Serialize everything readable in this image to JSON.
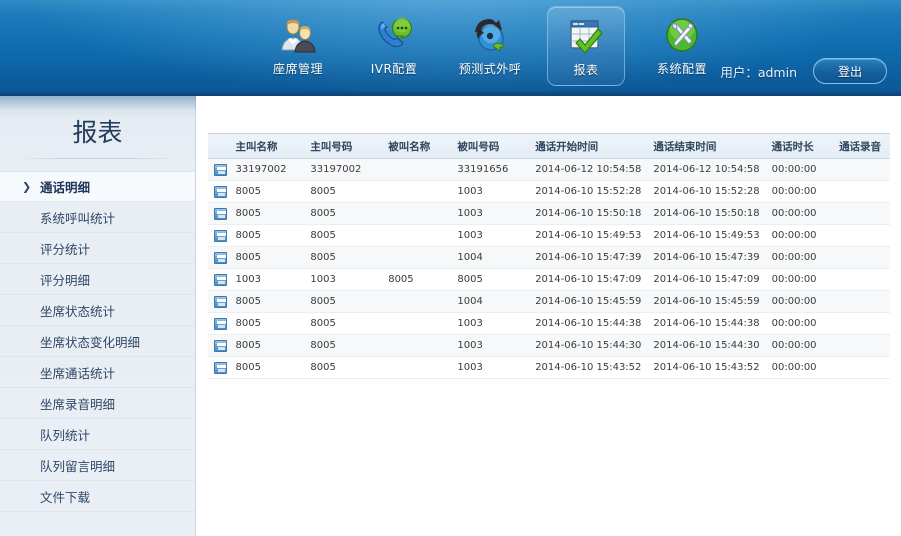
{
  "header": {
    "nav": [
      {
        "label": "座席管理",
        "icon": "users-icon",
        "active": false
      },
      {
        "label": "IVR配置",
        "icon": "phone-chat-icon",
        "active": false
      },
      {
        "label": "预测式外呼",
        "icon": "outbound-call-icon",
        "active": false
      },
      {
        "label": "报表",
        "icon": "report-checkmark-icon",
        "active": true
      },
      {
        "label": "系统配置",
        "icon": "tools-gear-icon",
        "active": false
      }
    ],
    "user_info": "用户：admin",
    "logout_label": "登出"
  },
  "sidebar": {
    "title": "报表",
    "items": [
      {
        "label": "通话明细",
        "active": true
      },
      {
        "label": "系统呼叫统计",
        "active": false
      },
      {
        "label": "评分统计",
        "active": false
      },
      {
        "label": "评分明细",
        "active": false
      },
      {
        "label": "坐席状态统计",
        "active": false
      },
      {
        "label": "坐席状态变化明细",
        "active": false
      },
      {
        "label": "坐席通话统计",
        "active": false
      },
      {
        "label": "坐席录音明细",
        "active": false
      },
      {
        "label": "队列统计",
        "active": false
      },
      {
        "label": "队列留言明细",
        "active": false
      },
      {
        "label": "文件下载",
        "active": false
      }
    ]
  },
  "table": {
    "columns": [
      "主叫名称",
      "主叫号码",
      "被叫名称",
      "被叫号码",
      "通话开始时间",
      "通话结束时间",
      "通话时长",
      "通话录音"
    ],
    "rows": [
      [
        "33197002",
        "33197002",
        "",
        "33191656",
        "2014-06-12 10:54:58",
        "2014-06-12 10:54:58",
        "00:00:00",
        ""
      ],
      [
        "8005",
        "8005",
        "",
        "1003",
        "2014-06-10 15:52:28",
        "2014-06-10 15:52:28",
        "00:00:00",
        ""
      ],
      [
        "8005",
        "8005",
        "",
        "1003",
        "2014-06-10 15:50:18",
        "2014-06-10 15:50:18",
        "00:00:00",
        ""
      ],
      [
        "8005",
        "8005",
        "",
        "1003",
        "2014-06-10 15:49:53",
        "2014-06-10 15:49:53",
        "00:00:00",
        ""
      ],
      [
        "8005",
        "8005",
        "",
        "1004",
        "2014-06-10 15:47:39",
        "2014-06-10 15:47:39",
        "00:00:00",
        ""
      ],
      [
        "1003",
        "1003",
        "8005",
        "8005",
        "2014-06-10 15:47:09",
        "2014-06-10 15:47:09",
        "00:00:00",
        ""
      ],
      [
        "8005",
        "8005",
        "",
        "1004",
        "2014-06-10 15:45:59",
        "2014-06-10 15:45:59",
        "00:00:00",
        ""
      ],
      [
        "8005",
        "8005",
        "",
        "1003",
        "2014-06-10 15:44:38",
        "2014-06-10 15:44:38",
        "00:00:00",
        ""
      ],
      [
        "8005",
        "8005",
        "",
        "1003",
        "2014-06-10 15:44:30",
        "2014-06-10 15:44:30",
        "00:00:00",
        ""
      ],
      [
        "8005",
        "8005",
        "",
        "1003",
        "2014-06-10 15:43:52",
        "2014-06-10 15:43:52",
        "00:00:00",
        ""
      ]
    ],
    "row_icon_name": "open-record-icon"
  },
  "colors": {
    "header_blue": "#1273b4",
    "header_dark": "#0b5694",
    "sidebar_bg": "#e8eef4",
    "accent_text": "#2f4766",
    "table_header_bg": "#e9f0f7"
  }
}
